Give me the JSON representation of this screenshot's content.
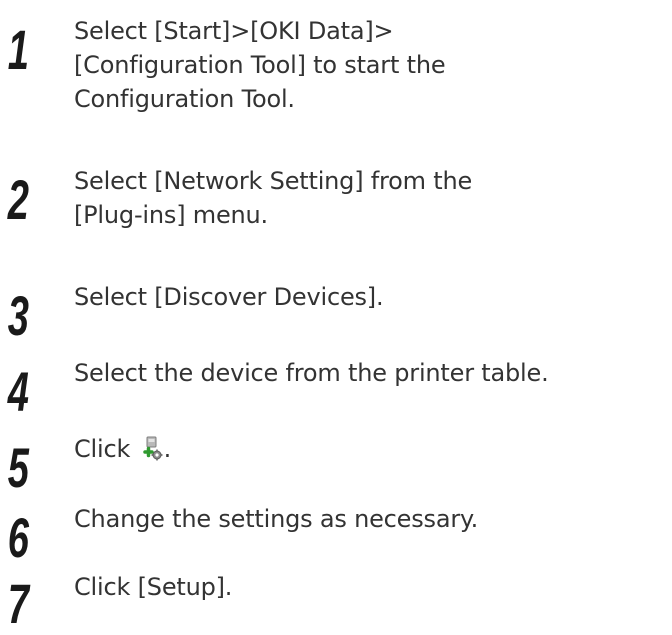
{
  "steps": [
    {
      "number": "1",
      "lines": [
        "Select [Start]>[OKI Data]>",
        "[Configuration Tool] to start the",
        "Configuration Tool."
      ]
    },
    {
      "number": "2",
      "lines": [
        "Select [Network Setting] from the",
        "[Plug-ins] menu."
      ]
    },
    {
      "number": "3",
      "lines": [
        "Select [Discover Devices]."
      ]
    },
    {
      "number": "4",
      "lines": [
        "Select the device from the printer table."
      ]
    },
    {
      "number": "5",
      "text_before_icon": "Click ",
      "icon": "device-settings-icon",
      "text_after_icon": "."
    },
    {
      "number": "6",
      "lines": [
        "Change the settings as necessary."
      ]
    },
    {
      "number": "7",
      "lines": [
        "Click [Setup]."
      ]
    }
  ]
}
